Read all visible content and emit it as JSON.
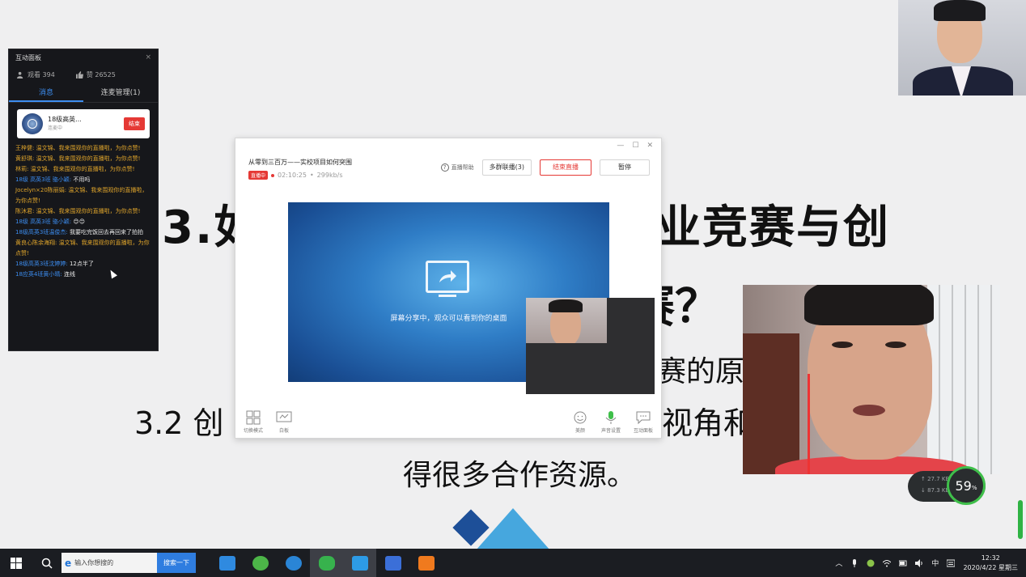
{
  "slide": {
    "title_left": "3.如",
    "title_right": "业竞赛与创",
    "title_line2": "赛？",
    "line_a": "赛的原",
    "line_b_left": "3.2 创",
    "line_b_right": "视角和",
    "line_c": "得很多合作资源。"
  },
  "panel": {
    "title": "互动面板",
    "close": "×",
    "viewers": "观看 394",
    "likes": "赞 26525",
    "tabs": [
      "消息",
      "连麦管理(1)"
    ],
    "group": {
      "name": "18级高英...",
      "sub": "连麦中",
      "button": "结束"
    },
    "messages": [
      {
        "who": "王梓健: ",
        "msg": "温文锦、我来围观你的直播啦，为你点赞!",
        "blue": false
      },
      {
        "who": "黄舒琪: ",
        "msg": "温文锦、我来围观你的直播啦，为你点赞!",
        "blue": false
      },
      {
        "who": "林莉: ",
        "msg": "温文锦、我来围观你的直播啦，为你点赞!",
        "blue": false
      },
      {
        "who": "18级 高英3班 骆小颖: ",
        "msg": "不用吗",
        "blue": true
      },
      {
        "who": "Jocelyn×20陈丽娟: ",
        "msg": "温文锦、我来围观你的直播啦，为你点赞!",
        "blue": false
      },
      {
        "who": "陈沐君: ",
        "msg": "温文锦、我来围观你的直播啦，为你点赞!",
        "blue": false
      },
      {
        "who": "18级 高英3班 骆小颖: ",
        "msg": "😊😊",
        "blue": true
      },
      {
        "who": "18级高英3班温俊杰: ",
        "msg": "我要吃完饭回去再回来了拍拍",
        "blue": true
      },
      {
        "who": "黄良心陈余海翔: ",
        "msg": "温文锦、我来围观你的直播啦，为你点赞!",
        "blue": false
      },
      {
        "who": "18级高英3班沈婷婷: ",
        "msg": "12点半了",
        "blue": true
      },
      {
        "who": "18应英4班黄小晴: ",
        "msg": "连线",
        "blue": true
      }
    ]
  },
  "live": {
    "title": "从零到三百万——实校项目如何突围",
    "tag": "直播中",
    "time": "02:10:25",
    "bitrate": "299kb/s",
    "help": "直播帮助",
    "multi_btn": "多群联播(3)",
    "end_btn": "结束直播",
    "pause_btn": "暂停",
    "share_text": "屏幕分享中，观众可以看到你的桌面",
    "tools_left": [
      "切换模式",
      "白板"
    ],
    "tools_right": [
      "美颜",
      "声音设置",
      "互动面板"
    ],
    "win_controls": [
      "—",
      "☐",
      "✕"
    ]
  },
  "net": {
    "up": "↑ 27.7 KB/s",
    "down": "↓ 87.3 KB/s",
    "percent": "59",
    "percent_unit": "%"
  },
  "taskbar": {
    "search_placeholder": "输入你想搜的",
    "search_button": "搜索一下",
    "ime": "中",
    "time": "12:32",
    "date": "2020/4/22 星期三"
  },
  "colors": {
    "accent_blue": "#3c8df0",
    "live_red": "#e53935",
    "panel_bg": "#16171b",
    "chat_gold": "#e0a52b"
  }
}
